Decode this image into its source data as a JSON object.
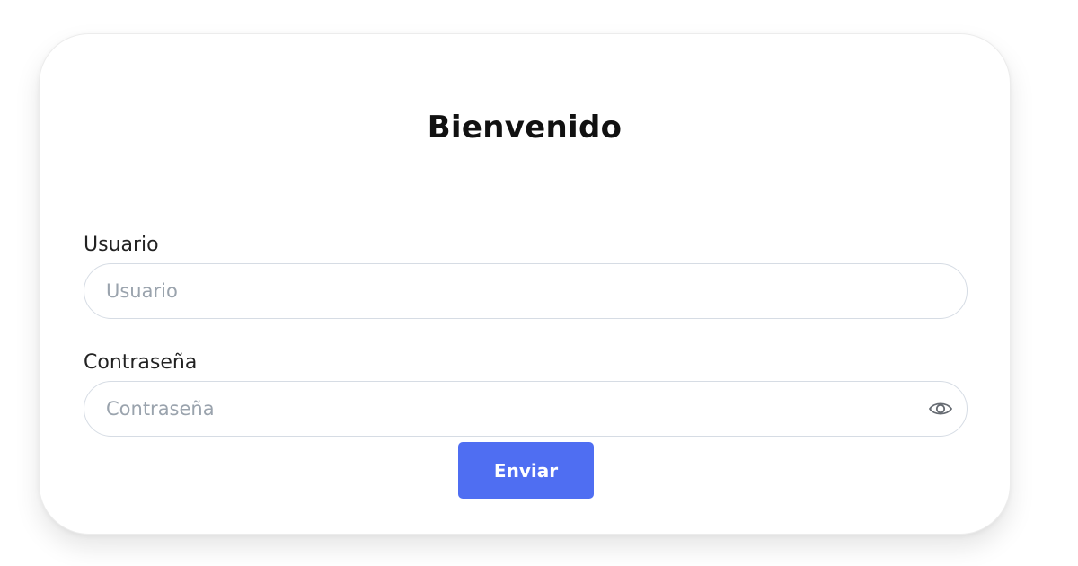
{
  "form": {
    "title": "Bienvenido",
    "username": {
      "label": "Usuario",
      "placeholder": "Usuario",
      "value": ""
    },
    "password": {
      "label": "Contraseña",
      "placeholder": "Contraseña",
      "value": "",
      "toggle_icon": "eye-icon"
    },
    "submit_label": "Enviar"
  },
  "colors": {
    "accent": "#4f6ef2",
    "input_border": "#d6dce4",
    "placeholder": "#9aa3ad",
    "title_text": "#111111"
  }
}
